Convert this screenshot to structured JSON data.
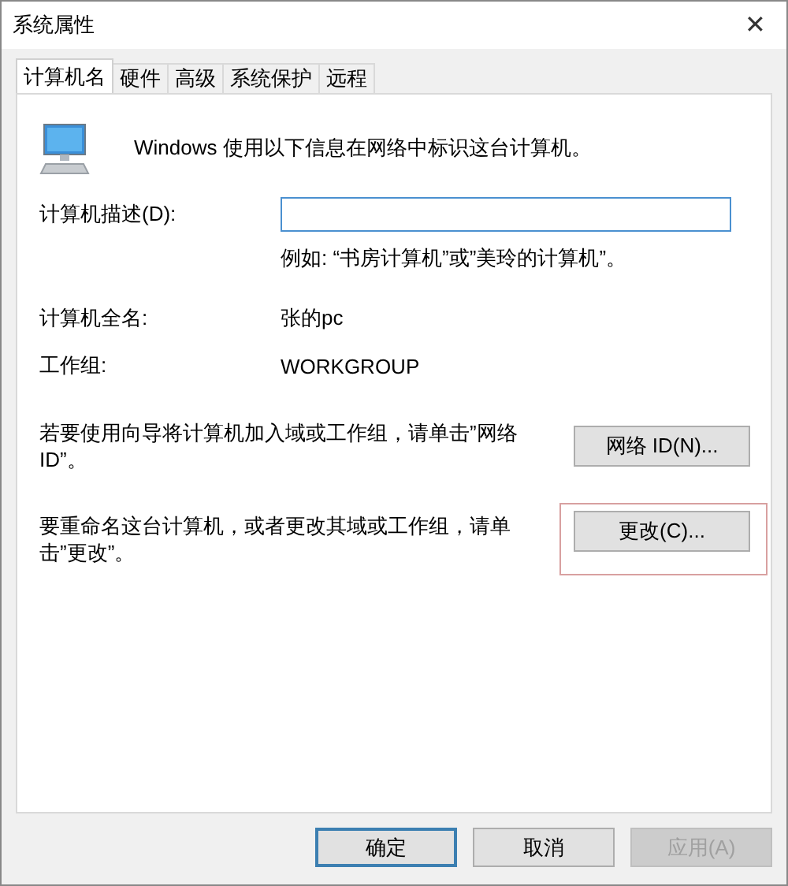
{
  "window": {
    "title": "系统属性",
    "close": "✕"
  },
  "tabs": [
    {
      "label": "计算机名",
      "selected": true
    },
    {
      "label": "硬件",
      "selected": false
    },
    {
      "label": "高级",
      "selected": false
    },
    {
      "label": "系统保护",
      "selected": false
    },
    {
      "label": "远程",
      "selected": false
    }
  ],
  "intro": "Windows 使用以下信息在网络中标识这台计算机。",
  "description": {
    "label": "计算机描述(D):",
    "hint": "例如: “书房计算机”或”美玲的计算机”。"
  },
  "fields": [
    {
      "label": "计算机全名:",
      "value": "张的pc"
    },
    {
      "label": "工作组:",
      "value": "WORKGROUP"
    }
  ],
  "actions": [
    {
      "text": "若要使用向导将计算机加入域或工作组，请单击”网络ID”。",
      "button": "网络 ID(N)...",
      "highlighted": false
    },
    {
      "text": "要重命名这台计算机，或者更改其域或工作组，请单击”更改”。",
      "button": "更改(C)...",
      "highlighted": true
    }
  ],
  "buttons": [
    {
      "label": "确定",
      "default": true,
      "disabled": false
    },
    {
      "label": "取消",
      "default": false,
      "disabled": false
    },
    {
      "label": "应用(A)",
      "default": false,
      "disabled": true
    }
  ]
}
